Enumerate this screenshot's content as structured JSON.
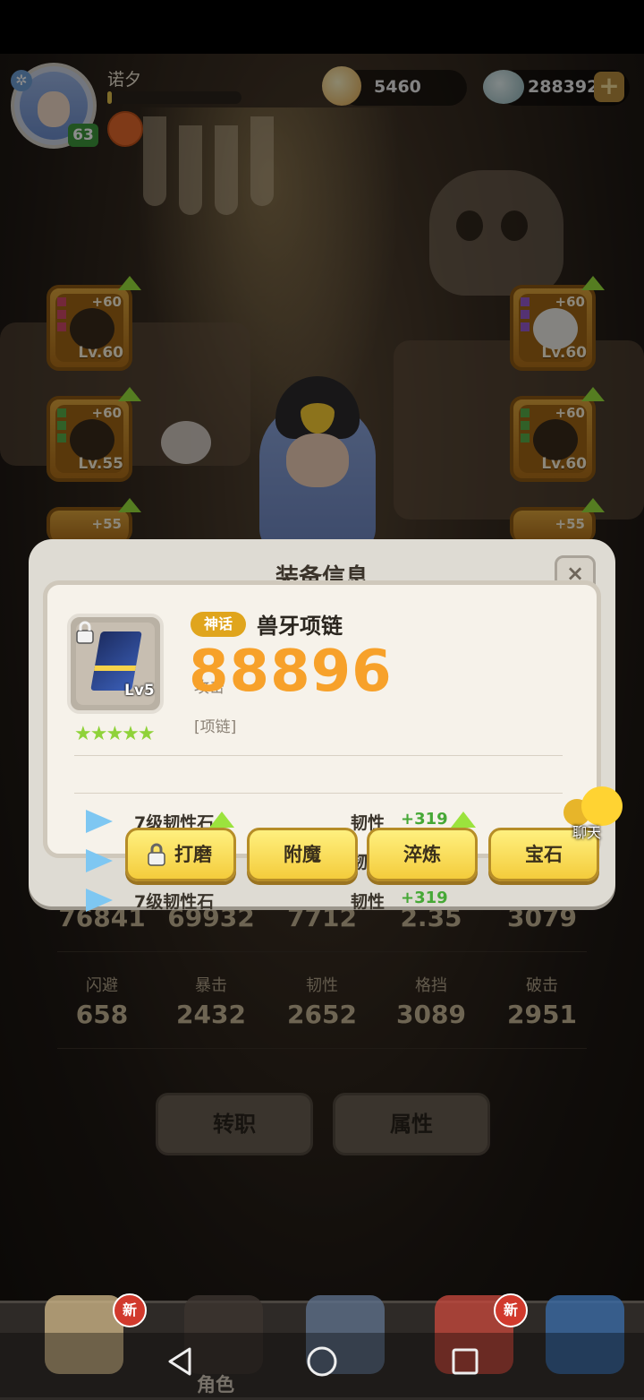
{
  "hud": {
    "player_name": "诺夕",
    "level": "63",
    "exp_ratio": 0.03,
    "currency_shell": "5460",
    "currency_gem": "288392",
    "add_currency": "+"
  },
  "slots": {
    "left_1": {
      "plus": "+60",
      "level": "Lv.60"
    },
    "left_2": {
      "plus": "+60",
      "level": "Lv.55"
    },
    "left_3": {
      "plus": "+55"
    },
    "right_1": {
      "plus": "+60",
      "level": "Lv.60"
    },
    "right_2": {
      "plus": "+60",
      "level": "Lv.60"
    },
    "right_3": {
      "plus": "+55"
    }
  },
  "dialog": {
    "title": "装备信息",
    "close": "×",
    "item": {
      "level": "Lv5",
      "stars": "★★★★★",
      "rarity": "神话",
      "name": "兽牙项链",
      "power": "88896",
      "stat_label": "攻击",
      "slot_type": "[项链]"
    },
    "gems": [
      {
        "name": "7级韧性石",
        "stat": "韧性",
        "value": "+319"
      },
      {
        "name": "",
        "stat": "韧",
        "value": ""
      },
      {
        "name": "7级韧性石",
        "stat": "韧性",
        "value": "+319"
      }
    ],
    "actions": {
      "grind": "打磨",
      "enchant": "附魔",
      "refine": "淬炼",
      "gem": "宝石"
    }
  },
  "chat": {
    "label": "聊天"
  },
  "stats": {
    "row1_values": [
      "76841",
      "69932",
      "7712",
      "2.35",
      "3079"
    ],
    "row2_labels": [
      "闪避",
      "暴击",
      "韧性",
      "格挡",
      "破击"
    ],
    "row2_values": [
      "658",
      "2432",
      "2652",
      "3089",
      "2951"
    ]
  },
  "buttons": {
    "job_change": "转职",
    "attributes": "属性"
  },
  "bottom_tabs": {
    "new_badge": "新",
    "role_label": "角色"
  },
  "colors": {
    "power": "#f7a12a",
    "gem_bonus": "#46a836",
    "rarity": "#e0a51d",
    "action_button": "#f4cc3c"
  }
}
